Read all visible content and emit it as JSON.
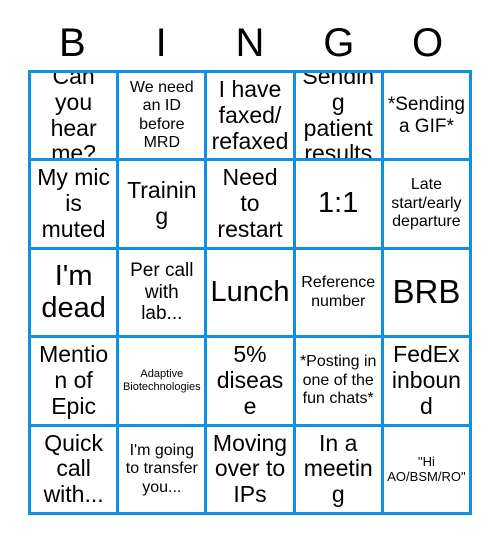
{
  "card": {
    "headers": [
      "B",
      "I",
      "N",
      "G",
      "O"
    ],
    "accent_color": "#1090e3",
    "text_color": "#000000",
    "background_color": "#ffffff",
    "rows": [
      [
        {
          "text": "Can you hear me?",
          "size": "lg"
        },
        {
          "text": "We need an ID before MRD",
          "size": "sm"
        },
        {
          "text": "I have faxed/ refaxed",
          "size": "lg"
        },
        {
          "text": "Sending patient results",
          "size": "lg"
        },
        {
          "text": "*Sending a GIF*",
          "size": "md"
        }
      ],
      [
        {
          "text": "My mic is muted",
          "size": "lg"
        },
        {
          "text": "Training",
          "size": "lg"
        },
        {
          "text": "Need to restart",
          "size": "lg"
        },
        {
          "text": "1:1",
          "size": "xl"
        },
        {
          "text": "Late start/early departure",
          "size": "sm"
        }
      ],
      [
        {
          "text": "I'm dead",
          "size": "xl"
        },
        {
          "text": "Per call with lab...",
          "size": "md"
        },
        {
          "text": "Lunch",
          "size": "xl"
        },
        {
          "text": "Reference number",
          "size": "sm"
        },
        {
          "text": "BRB",
          "size": "xxl"
        }
      ],
      [
        {
          "text": "Mention of Epic",
          "size": "lg"
        },
        {
          "text": "Adaptive Biotechnologies",
          "size": "xxs"
        },
        {
          "text": "5% disease",
          "size": "lg"
        },
        {
          "text": "*Posting in one of the fun chats*",
          "size": "sm"
        },
        {
          "text": "FedEx inbound",
          "size": "lg"
        }
      ],
      [
        {
          "text": "Quick call with...",
          "size": "lg"
        },
        {
          "text": "I'm going to transfer you...",
          "size": "sm"
        },
        {
          "text": "Moving over to IPs",
          "size": "lg"
        },
        {
          "text": "In a meeting",
          "size": "lg"
        },
        {
          "text": "\"Hi AO/BSM/RO\"",
          "size": "xs"
        }
      ]
    ]
  }
}
